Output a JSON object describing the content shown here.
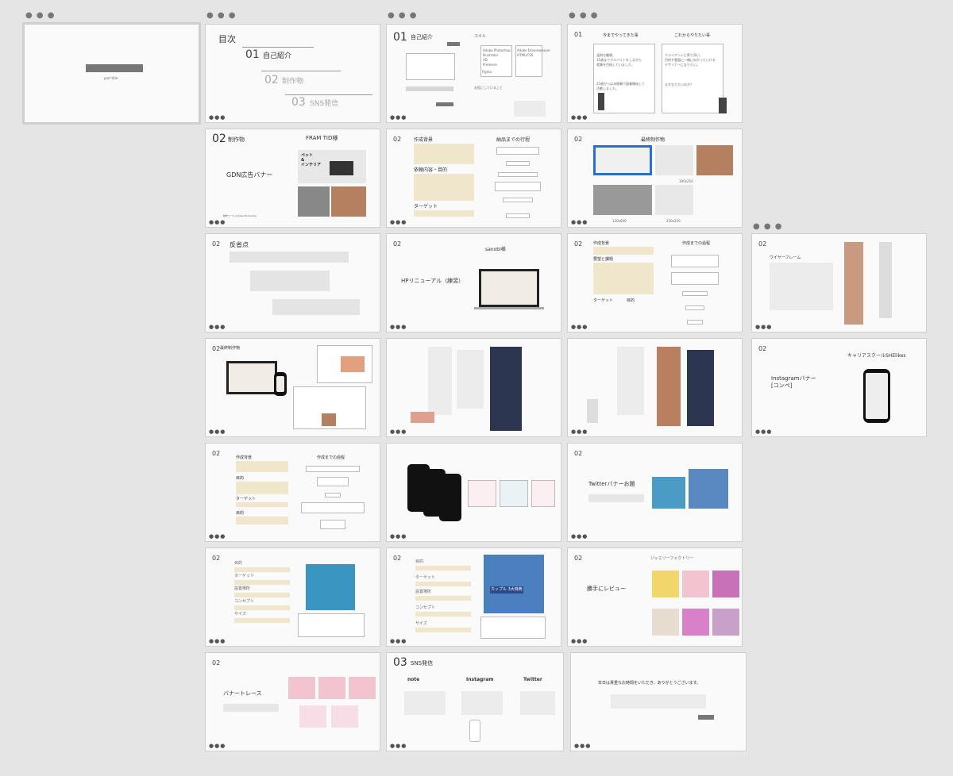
{
  "row1": {
    "s1": {
      "sub": "part title"
    },
    "s2": {
      "title": "目次",
      "items": [
        {
          "num": "01",
          "label": "自己紹介"
        },
        {
          "num": "02",
          "label": "制作物"
        },
        {
          "num": "03",
          "label": "SNS発信"
        }
      ]
    },
    "s3": {
      "num": "01",
      "title": "自己紹介",
      "skill": "スキル",
      "tools": "Adobe Photoshop\nIllustrator\nXD\nPremiere",
      "figma": "Figma",
      "tool2": "Adobe Dreamweaver\nHTML/CSS",
      "doing": "お役にしていること"
    },
    "s4": {
      "num": "01",
      "left_title": "今までやってきた事",
      "right_title": "これからやりたい事",
      "left_body": "温和な職場、\n15歳までアルバイトをしながら\n就業を目指していました。",
      "left_body2": "25歳からは未経験で副業開始して\n活動しました。",
      "right_body": "クライアントに寄り添い、\n目的や意図に一緒に向かっていける\nデザイナーになりたい。",
      "right_body2": "なぜなりたいのか？"
    }
  },
  "row2": {
    "s5": {
      "num": "02",
      "label": "制作物",
      "title": "FRAM TID様",
      "sub": "GDN広告バナー",
      "banner_text": "ペット\n&\nインテリア",
      "foot": "制作ツール:Adobe Photoshop"
    },
    "s6": {
      "num": "02",
      "t1": "作成背景",
      "t2": "納品までの行程",
      "t3": "依頼内容・目的",
      "t4": "ターゲット"
    },
    "s7": {
      "num": "02",
      "title": "最終制作物",
      "sizes": [
        "300x250",
        "120x600",
        "250x250"
      ]
    }
  },
  "row3": {
    "s8": {
      "num": "02",
      "title": "反省点"
    },
    "s9": {
      "num": "02",
      "title": "sanobi様",
      "sub": "HPリニューアル（練習）"
    },
    "s10": {
      "num": "02",
      "t1": "作成背景",
      "t2": "作成までの過程",
      "t3": "要望と課題",
      "t4": "ターゲット",
      "t5": "目的"
    },
    "s11": {
      "num": "02",
      "title": "ワイヤーフレーム"
    }
  },
  "row4": {
    "s12": {
      "num": "02",
      "title": "最終制作物"
    },
    "s13": {},
    "s14": {},
    "s15": {
      "num": "02",
      "title": "キャリアスクールSHElikes",
      "sub": "Instagramバナー\n[コンペ]"
    }
  },
  "row5": {
    "s16": {
      "num": "02",
      "t1": "作成背景",
      "t2": "作成までの過程",
      "t3": "目的",
      "t4": "ターゲット",
      "t5": "目的"
    },
    "s17": {},
    "s18": {
      "num": "02",
      "title": "Twitterバナーお題"
    }
  },
  "row6": {
    "s19": {
      "num": "02",
      "labels": [
        "目的",
        "ターゲット",
        "設置場所",
        "コンセプト",
        "サイズ"
      ]
    },
    "s20": {
      "num": "02",
      "labels": [
        "目的",
        "ターゲット",
        "設置場所",
        "コンセプト",
        "サイズ"
      ],
      "banner": "カップル 3大特典"
    },
    "s21": {
      "num": "02",
      "title": "勝手にレビュー",
      "sub": "ジュエリーフェクトリー"
    }
  },
  "row7": {
    "s22": {
      "num": "02",
      "title": "バナートレース"
    },
    "s23": {
      "num": "03",
      "title": "SNS発信",
      "cols": [
        "note",
        "Instagram",
        "Twitter"
      ]
    },
    "s24": {
      "title": "本日は貴重なお時間をいただき、ありがとうございます。"
    }
  },
  "colors": {
    "bg": "#e5e5e5",
    "slide": "#fafafa",
    "beige": "#efe6cc",
    "navy": "#2c3650"
  }
}
